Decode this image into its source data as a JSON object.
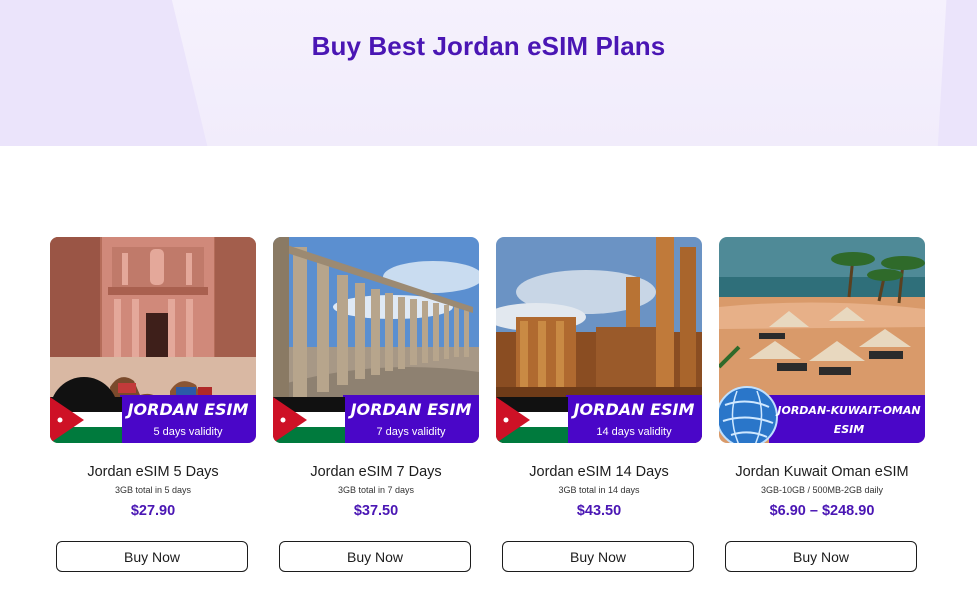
{
  "hero": {
    "title": "Buy Best Jordan eSIM Plans"
  },
  "products": [
    {
      "name": "Jordan eSIM 5 Days",
      "data": "3GB total in 5 days",
      "price": "$27.90",
      "button": "Buy Now",
      "banner_title": "JORDAN ESIM",
      "banner_sub": "5 days validity",
      "image": "petra-treasury"
    },
    {
      "name": "Jordan eSIM 7 Days",
      "data": "3GB total in 7 days",
      "price": "$37.50",
      "button": "Buy Now",
      "banner_title": "JORDAN ESIM",
      "banner_sub": "7 days validity",
      "image": "jerash-colonnade"
    },
    {
      "name": "Jordan eSIM 14 Days",
      "data": "3GB total in 14 days",
      "price": "$43.50",
      "button": "Buy Now",
      "banner_title": "JORDAN ESIM",
      "banner_sub": "14 days validity",
      "image": "jerash-ruins"
    },
    {
      "name": "Jordan Kuwait Oman eSIM",
      "data": "3GB-10GB / 500MB-2GB daily",
      "price": "$6.90 – $248.90",
      "button": "Buy Now",
      "banner_title": "JORDAN-KUWAIT-OMAN",
      "banner_sub": "ESIM",
      "image": "beach-palms"
    }
  ],
  "colors": {
    "brand": "#4a16b4",
    "banner": "#4a06c8",
    "flag_red": "#ce1126",
    "flag_green": "#007a3d"
  }
}
